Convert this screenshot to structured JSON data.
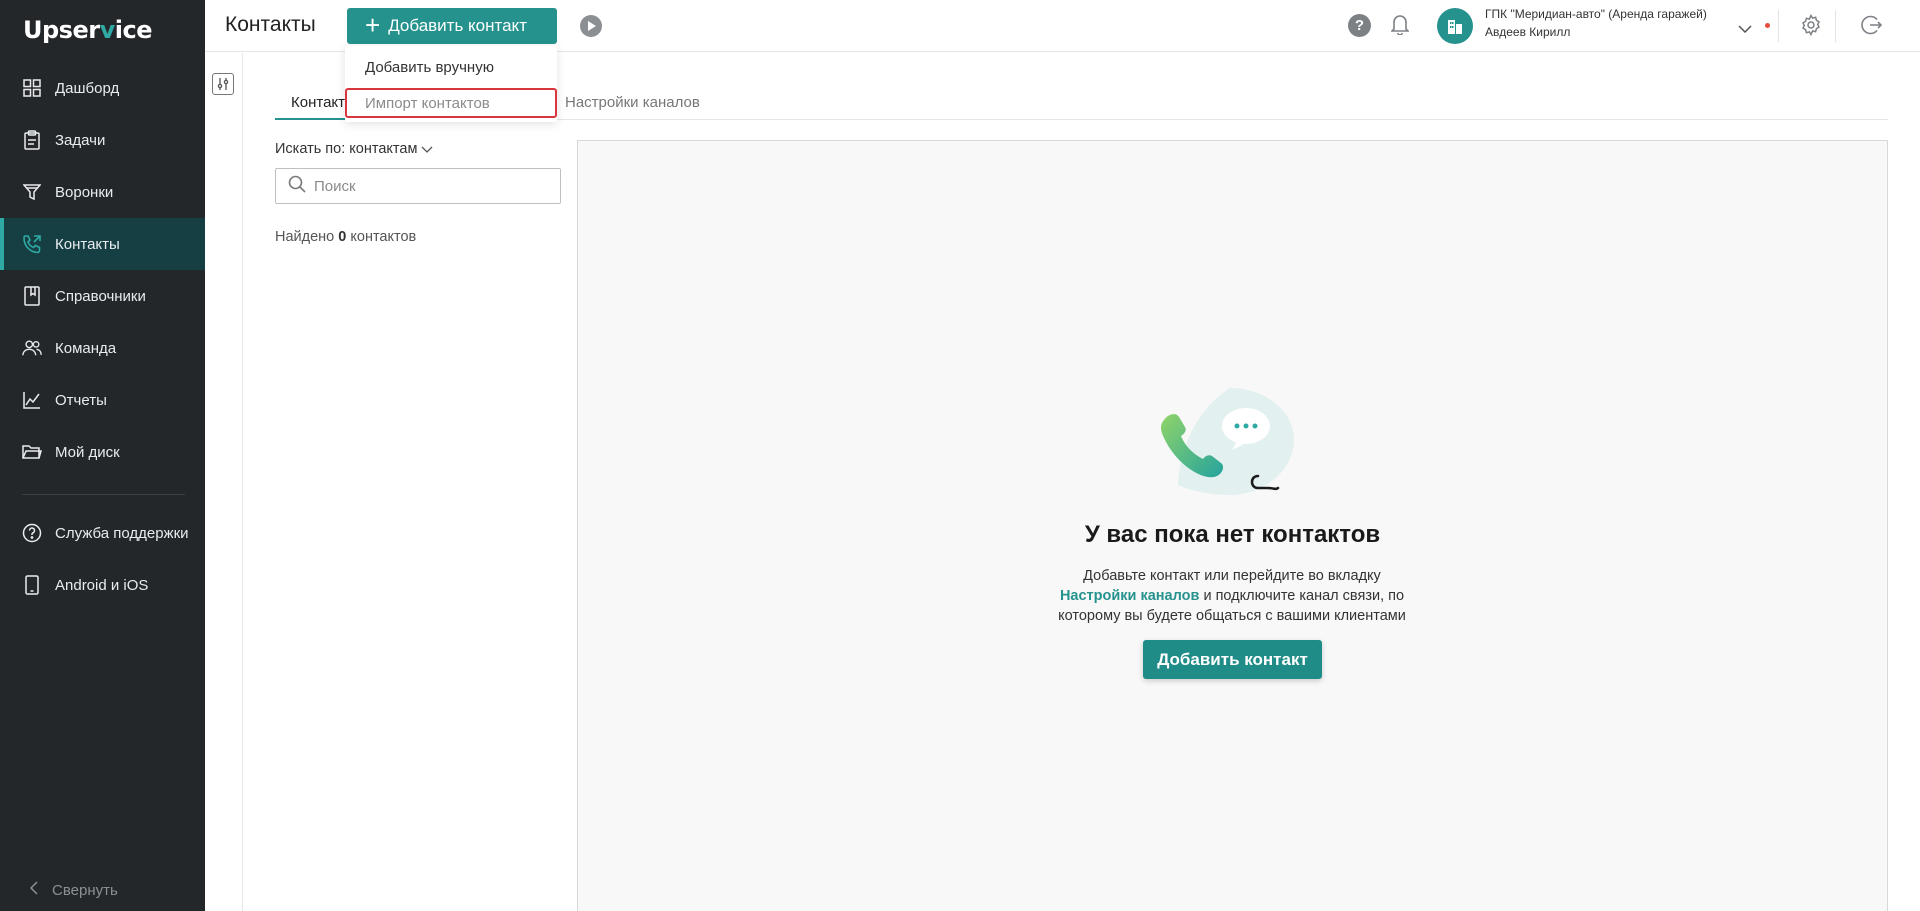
{
  "app": {
    "logo_prefix": "Upser",
    "logo_v": "v",
    "logo_suffix": "ice"
  },
  "sidebar": {
    "items": [
      {
        "label": "Дашборд",
        "icon": "dashboard-icon"
      },
      {
        "label": "Задачи",
        "icon": "tasks-icon"
      },
      {
        "label": "Воронки",
        "icon": "funnel-icon"
      },
      {
        "label": "Контакты",
        "icon": "contacts-phone-icon",
        "active": true
      },
      {
        "label": "Справочники",
        "icon": "book-icon"
      },
      {
        "label": "Команда",
        "icon": "team-icon"
      },
      {
        "label": "Отчеты",
        "icon": "chart-icon"
      },
      {
        "label": "Мой диск",
        "icon": "folder-icon"
      }
    ],
    "bottom_items": [
      {
        "label": "Служба поддержки",
        "icon": "help-circle-icon"
      },
      {
        "label": "Android и iOS",
        "icon": "mobile-icon"
      }
    ],
    "collapse_label": "Свернуть"
  },
  "header": {
    "title": "Контакты",
    "add_button": "Добавить контакт",
    "help": "?",
    "org_name": "ГПК \"Меридиан-авто\" (Аренда гаражей)",
    "user_name": "Авдеев Кирилл"
  },
  "dropdown": {
    "items": [
      "Добавить вручную",
      "Импорт контактов"
    ]
  },
  "tabs": [
    "Контакты",
    "Настройки каналов"
  ],
  "tab_active_visible": "Контакт",
  "search": {
    "by_label": "Искать по: контактам",
    "placeholder": "Поиск",
    "value": ""
  },
  "found": {
    "prefix": "Найдено",
    "count": "0",
    "suffix": "контактов"
  },
  "empty_state": {
    "title": "У вас пока нет контактов",
    "desc_line1": "Добавьте контакт или перейдите во вкладку",
    "link": "Настройки каналов",
    "desc_line2": "и подключите канал связи, по",
    "desc_line3": "которому вы будете общаться с вашими клиентами",
    "button": "Добавить контакт"
  },
  "colors": {
    "accent": "#25928e",
    "sidebar_bg": "#242729",
    "sidebar_active": "#163f44",
    "highlight": "#d9363e"
  }
}
